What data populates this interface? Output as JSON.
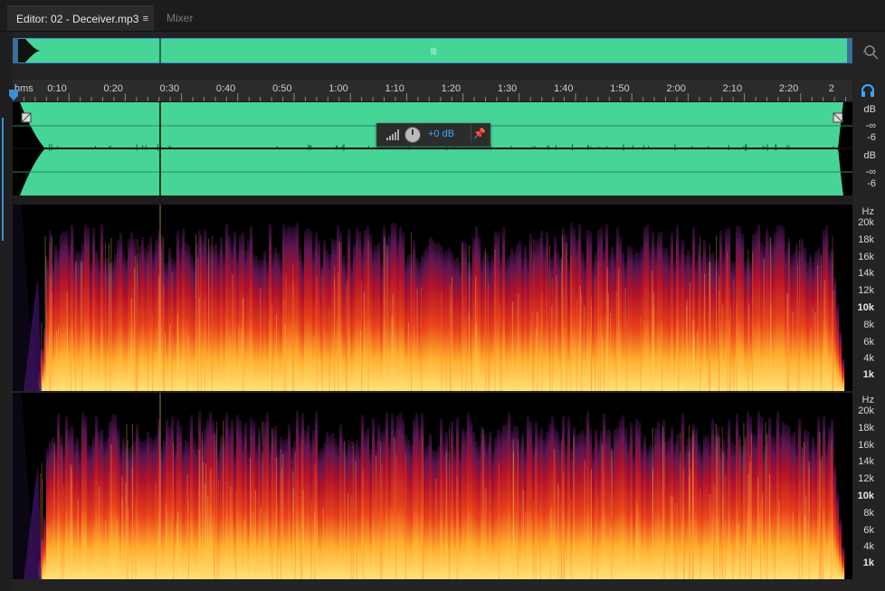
{
  "tabs": {
    "editor_label": "Editor: 02 - Deceiver.mp3",
    "editor_menu": "≡",
    "mixer_label": "Mixer"
  },
  "ruler": {
    "unit_label": "hms",
    "ticks": [
      "0:10",
      "0:20",
      "0:30",
      "0:40",
      "0:50",
      "1:00",
      "1:10",
      "1:20",
      "1:30",
      "1:40",
      "1:50",
      "2:00",
      "2:10",
      "2:20",
      "2"
    ]
  },
  "hud": {
    "gain": "+0 dB",
    "pin_icon": "pin-icon"
  },
  "db_scale": {
    "ch1": [
      "dB",
      "-∞",
      "-6"
    ],
    "ch2": [
      "dB",
      "-∞",
      "-6"
    ]
  },
  "hz_scale": {
    "unit": "Hz",
    "labels": [
      "20k",
      "18k",
      "16k",
      "14k",
      "12k",
      "10k",
      "8k",
      "6k",
      "4k",
      "1k"
    ]
  },
  "colors": {
    "waveform": "#46d597",
    "accent": "#3aa7ff",
    "background": "#232323"
  }
}
